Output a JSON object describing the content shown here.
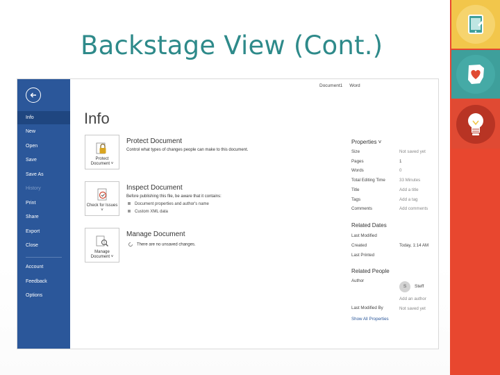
{
  "slide": {
    "title": "Backstage View (Cont.)"
  },
  "colors": {
    "title": "#2e8a8a",
    "sidebar": "#2b579a",
    "sidebar_active": "#1f4680",
    "deco_bar": "#e8472f",
    "deco_yellow": "#f2c64b",
    "deco_teal": "#3e9f9b"
  },
  "window": {
    "title_parts": [
      "Document1",
      "Word"
    ]
  },
  "sidebar": {
    "back_icon": "back-arrow-icon",
    "items": [
      {
        "label": "Info",
        "state": "active"
      },
      {
        "label": "New",
        "state": "normal"
      },
      {
        "label": "Open",
        "state": "normal"
      },
      {
        "label": "Save",
        "state": "normal"
      },
      {
        "label": "Save As",
        "state": "normal"
      },
      {
        "label": "History",
        "state": "disabled"
      },
      {
        "label": "Print",
        "state": "normal"
      },
      {
        "label": "Share",
        "state": "normal"
      },
      {
        "label": "Export",
        "state": "normal"
      },
      {
        "label": "Close",
        "state": "normal"
      }
    ],
    "bottom_items": [
      {
        "label": "Account"
      },
      {
        "label": "Feedback"
      },
      {
        "label": "Options"
      }
    ]
  },
  "main": {
    "heading": "Info",
    "sections": [
      {
        "tile_label": "Protect Document ˅",
        "tile_icon": "lock-icon",
        "title": "Protect Document",
        "description": "Control what types of changes people can make to this document.",
        "bullets": []
      },
      {
        "tile_label": "Check for Issues ˅",
        "tile_icon": "checklist-icon",
        "title": "Inspect Document",
        "description": "Before publishing this file, be aware that it contains:",
        "bullets": [
          "Document properties and author's name",
          "Custom XML data"
        ]
      },
      {
        "tile_label": "Manage Document ˅",
        "tile_icon": "document-search-icon",
        "title": "Manage Document",
        "description": "There are no unsaved changes.",
        "bullets": []
      }
    ]
  },
  "properties": {
    "heading": "Properties ˅",
    "rows": [
      {
        "label": "Size",
        "value": "Not saved yet"
      },
      {
        "label": "Pages",
        "value": "1"
      },
      {
        "label": "Words",
        "value": "0"
      },
      {
        "label": "Total Editing Time",
        "value": "33 Minutes"
      },
      {
        "label": "Title",
        "value": "Add a title"
      },
      {
        "label": "Tags",
        "value": "Add a tag"
      },
      {
        "label": "Comments",
        "value": "Add comments"
      }
    ],
    "related_dates": {
      "heading": "Related Dates",
      "rows": [
        {
          "label": "Last Modified",
          "value": ""
        },
        {
          "label": "Created",
          "value": "Today, 1:14 AM"
        },
        {
          "label": "Last Printed",
          "value": ""
        }
      ]
    },
    "related_people": {
      "heading": "Related People",
      "author_label": "Author",
      "author_initial": "S",
      "author_name": "Steff",
      "add_author": "Add an author",
      "last_modified_by_label": "Last Modified By",
      "last_modified_by_value": "Not saved yet"
    },
    "show_all": "Show All Properties"
  }
}
